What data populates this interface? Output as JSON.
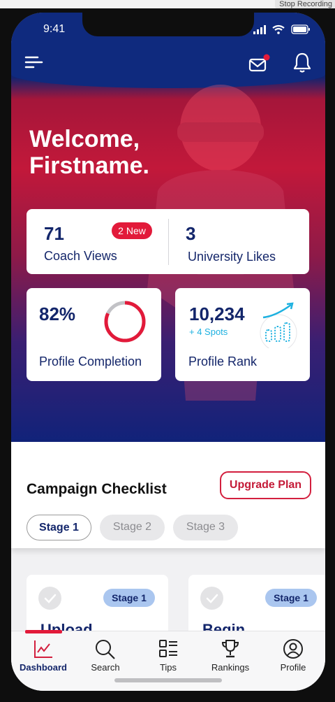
{
  "recorder": {
    "stop_label": "Stop Recording"
  },
  "status_bar": {
    "time": "9:41"
  },
  "header": {
    "menu_icon": "menu-icon",
    "mail_icon": "mail-icon",
    "bell_icon": "bell-icon"
  },
  "hero": {
    "welcome_line1": "Welcome,",
    "welcome_line2": "Firstname."
  },
  "stats": {
    "coach_views": "71",
    "coach_views_label": "Coach Views",
    "new_badge": "2 New",
    "university_likes": "3",
    "university_likes_label": "University Likes",
    "profile_completion": "82%",
    "profile_completion_label": "Profile Completion",
    "profile_completion_value": 0.82,
    "profile_rank": "10,234",
    "profile_rank_delta": "+ 4 Spots",
    "profile_rank_label": "Profile Rank"
  },
  "checklist": {
    "title": "Campaign Checklist",
    "upgrade_label": "Upgrade Plan",
    "tabs": [
      "Stage 1",
      "Stage 2",
      "Stage 3"
    ],
    "tasks": [
      {
        "badge": "Stage 1",
        "title": "Upload..."
      },
      {
        "badge": "Stage 1",
        "title": "Begin..."
      }
    ]
  },
  "tabbar": {
    "items": [
      {
        "label": "Dashboard",
        "icon": "chart-icon",
        "active": true
      },
      {
        "label": "Search",
        "icon": "search-icon",
        "active": false
      },
      {
        "label": "Tips",
        "icon": "tips-icon",
        "active": false
      },
      {
        "label": "Rankings",
        "icon": "trophy-icon",
        "active": false
      },
      {
        "label": "Profile",
        "icon": "profile-icon",
        "active": false
      }
    ]
  },
  "colors": {
    "navy": "#13266b",
    "red": "#e21a3a",
    "accent_blue": "#1db1e0"
  }
}
